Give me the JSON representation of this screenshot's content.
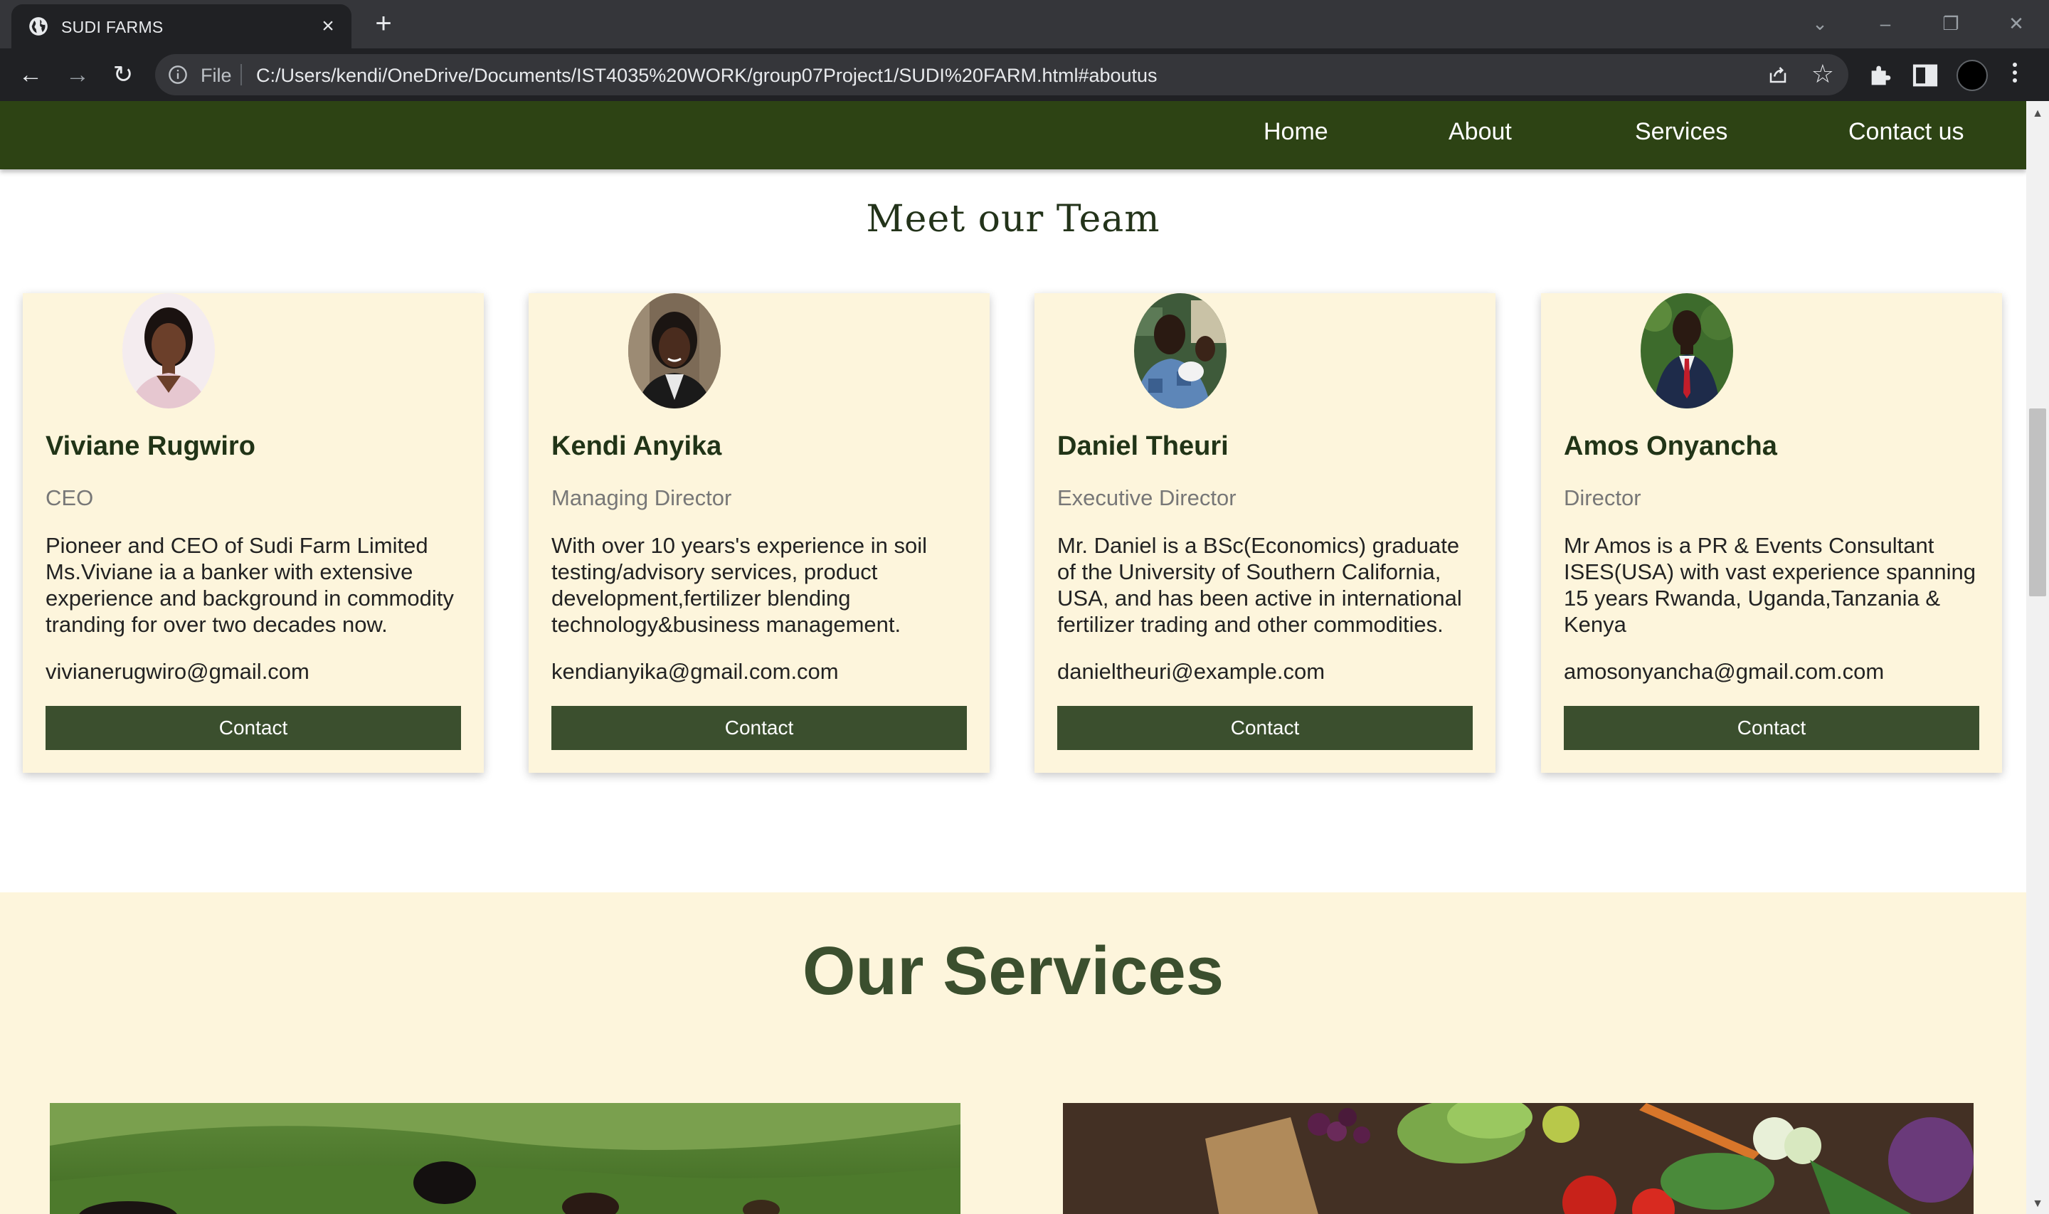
{
  "browser": {
    "tab_title": "SUDI FARMS",
    "omnibox_scheme": "File",
    "url": "C:/Users/kendi/OneDrive/Documents/IST4035%20WORK/group07Project1/SUDI%20FARM.html#aboutus"
  },
  "nav": {
    "home": "Home",
    "about": "About",
    "services": "Services",
    "contact": "Contact us"
  },
  "team": {
    "title": "Meet our Team",
    "members": [
      {
        "name": "Viviane Rugwiro",
        "role": "CEO",
        "bio": "Pioneer and CEO of Sudi Farm Limited Ms.Viviane ia a banker with extensive experience and background in commodity tranding for over two decades now.",
        "email": "vivianerugwiro@gmail.com",
        "button": "Contact"
      },
      {
        "name": "Kendi Anyika",
        "role": "Managing Director",
        "bio": "With over 10 years's experience in soil testing/advisory services, product development,fertilizer blending technology&business management.",
        "email": "kendianyika@gmail.com.com",
        "button": "Contact"
      },
      {
        "name": "Daniel Theuri",
        "role": "Executive Director",
        "bio": "Mr. Daniel is a BSc(Economics) graduate of the University of Southern California, USA, and has been active in international fertilizer trading and other commodities.",
        "email": "danieltheuri@example.com",
        "button": "Contact"
      },
      {
        "name": "Amos Onyancha",
        "role": "Director",
        "bio": "Mr Amos is a PR & Events Consultant ISES(USA) with vast experience spanning 15 years Rwanda, Uganda,Tanzania & Kenya",
        "email": "amosonyancha@gmail.com.com",
        "button": "Contact"
      }
    ]
  },
  "services": {
    "title": "Our Services"
  },
  "colors": {
    "nav_bg": "#2d4314",
    "card_bg": "#fdf5dc",
    "button_bg": "#3b4f2e",
    "heading": "#3b4f2e"
  }
}
